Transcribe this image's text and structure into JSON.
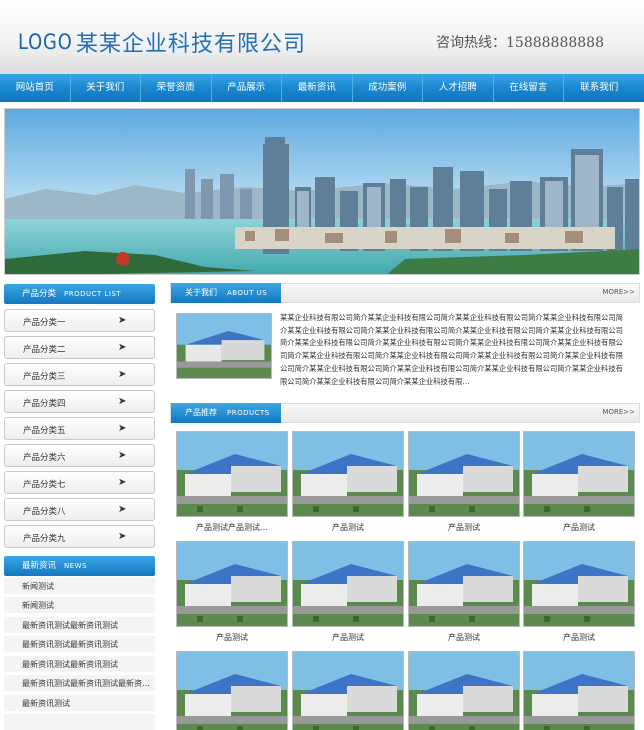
{
  "header": {
    "logo": "LOGO",
    "company": "某某企业科技有限公司",
    "hotline_label": "咨询热线：",
    "hotline_number": "15888888888"
  },
  "nav": [
    "网站首页",
    "关于我们",
    "荣誉资质",
    "产品展示",
    "最新资讯",
    "成功案例",
    "人才招聘",
    "在线留言",
    "联系我们"
  ],
  "sidebar": {
    "products_title": "产品分类",
    "products_title_en": "PRODUCT LIST",
    "categories": [
      "产品分类一",
      "产品分类二",
      "产品分类三",
      "产品分类四",
      "产品分类五",
      "产品分类六",
      "产品分类七",
      "产品分类八",
      "产品分类九"
    ],
    "arrow_icon": "chevron-right-icon",
    "news_title": "最新资讯",
    "news_title_en": "NEWS",
    "news": [
      "新闻测试",
      "新闻测试",
      "最新资讯测试最新资讯测试",
      "最新资讯测试最新资讯测试",
      "最新资讯测试最新资讯测试",
      "最新资讯测试最新资讯测试最新资…",
      "最新资讯测试"
    ]
  },
  "about": {
    "title": "关于我们",
    "title_en": "ABOUT US",
    "more": "MORE>>",
    "text": "某某企业科技有限公司简介某某企业科技有限公司简介某某企业科技有限公司简介某某企业科技有限公司简介某某企业科技有限公司简介某某企业科技有限公司简介某某企业科技有限公司简介某某企业科技有限公司简介某某企业科技有限公司简介某某企业科技有限公司简介某某企业科技有限公司简介某某企业科技有限公司简介某某企业科技有限公司简介某某企业科技有限公司简介某某企业科技有限公司简介某某企业科技有限公司简介某某企业科技有限公司简介某某企业科技有限公司简介某某企业科技有限公司简介某某企业科技有限公司简介某某企业科技有限公司简介某某企业科技有限…"
  },
  "products": {
    "title": "产品推荐",
    "title_en": "PRODUCTS",
    "more": "MORE>>",
    "items": [
      "产品测试产品测试…",
      "产品测试",
      "产品测试",
      "产品测试",
      "产品测试",
      "产品测试",
      "产品测试",
      "产品测试",
      "",
      "",
      "",
      ""
    ]
  },
  "colors": {
    "accent": "#1b87cf",
    "brand_text": "#2270b8",
    "nav_divider": "#4fb0e8"
  }
}
